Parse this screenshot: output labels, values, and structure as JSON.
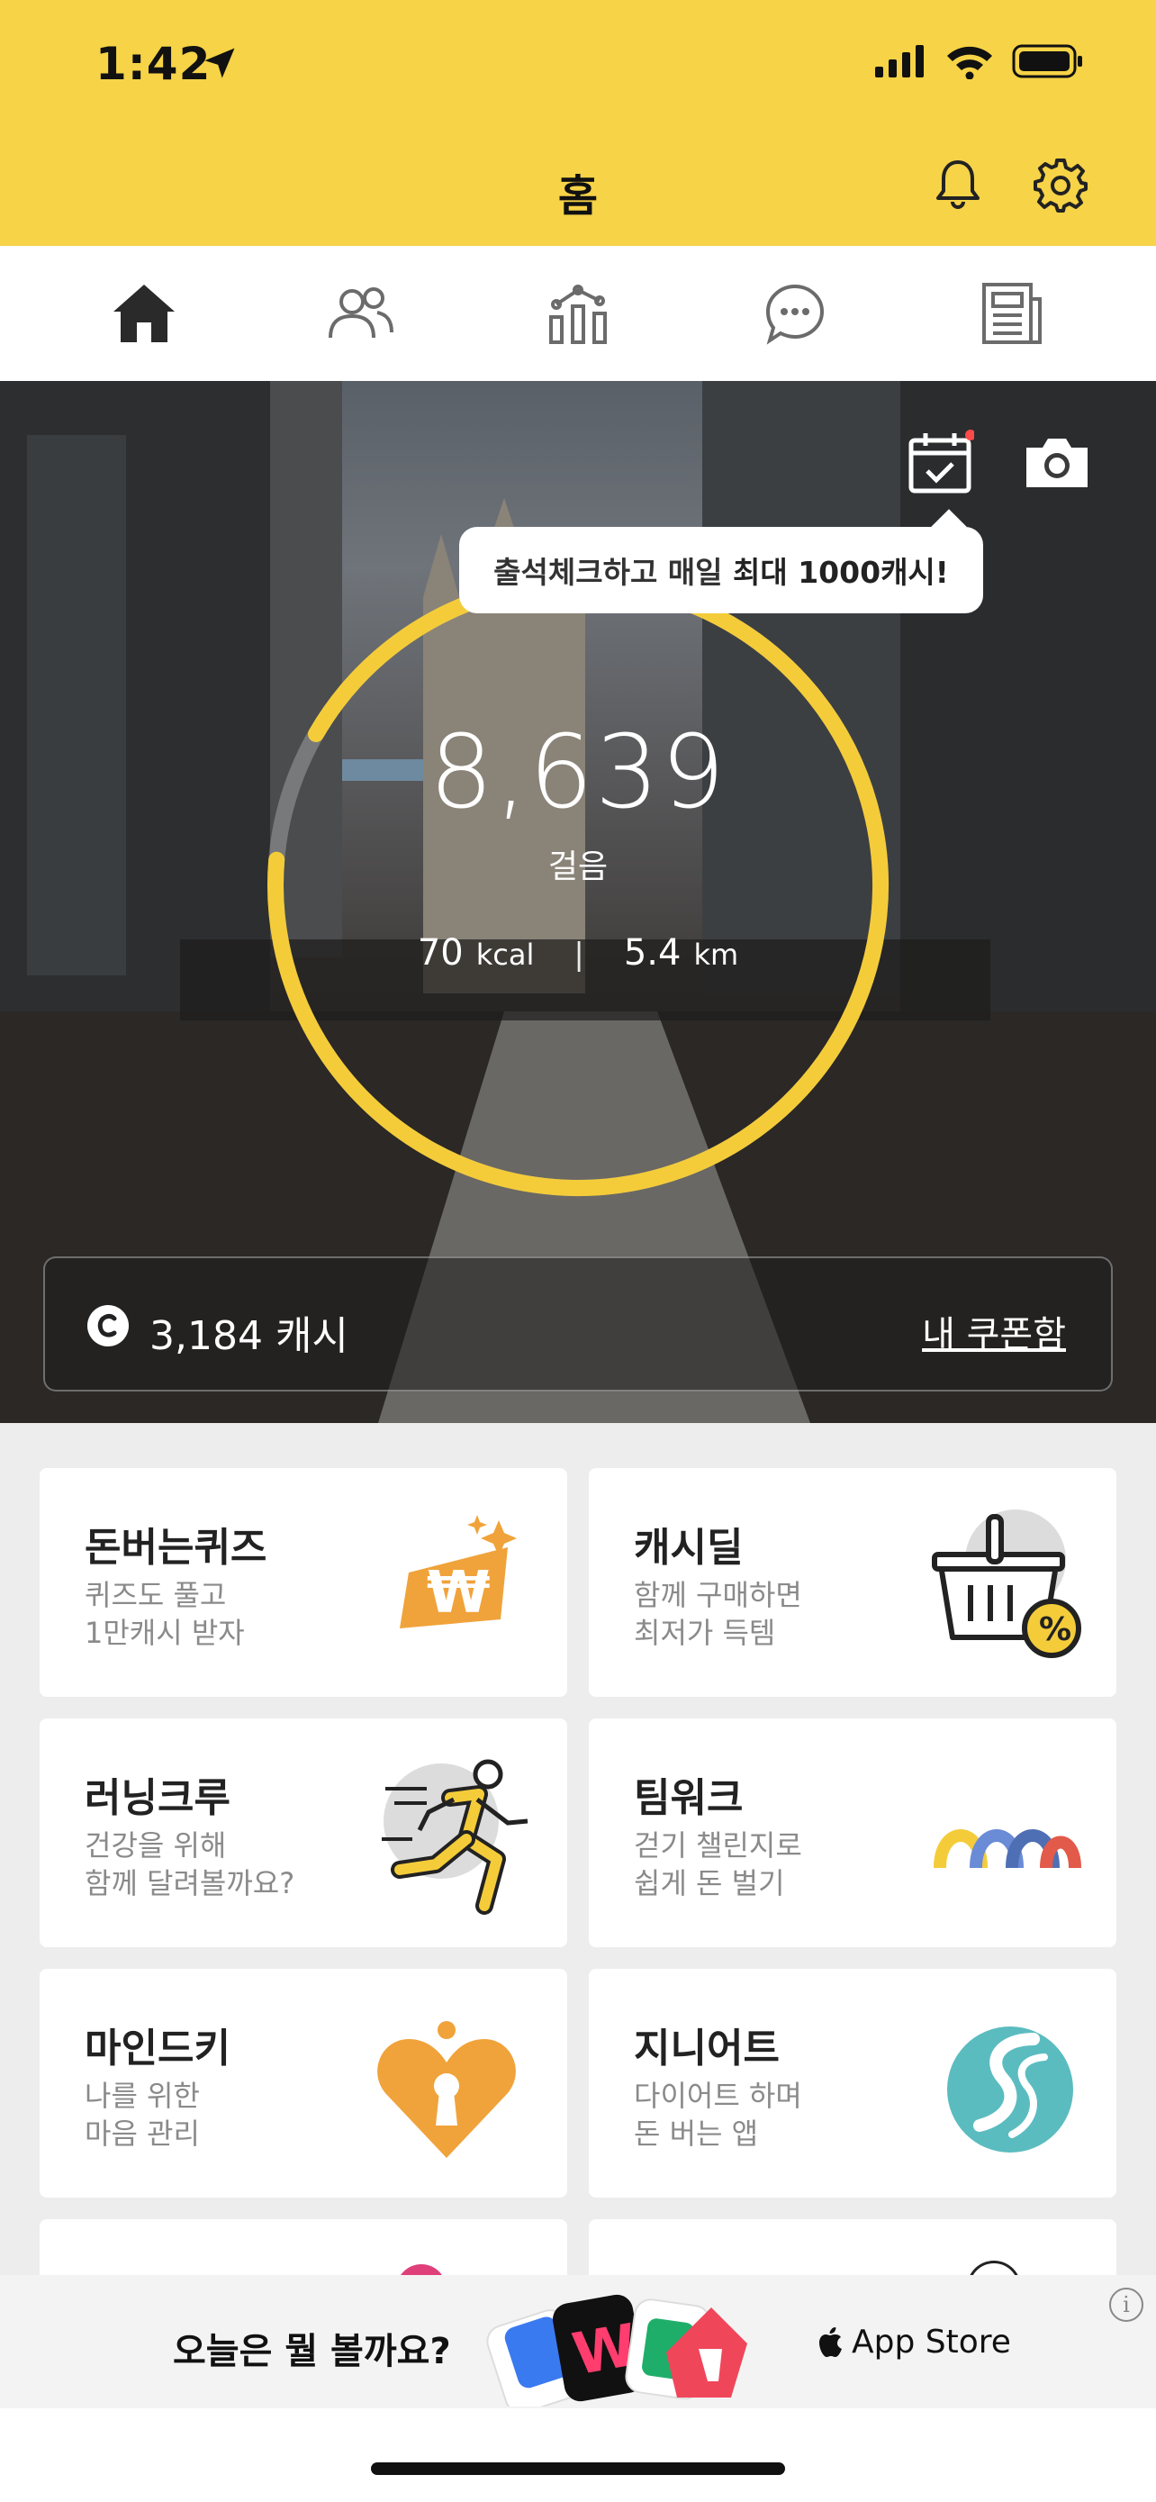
{
  "status_bar": {
    "time": "1:42"
  },
  "header": {
    "title": "홈",
    "icons": [
      "bell-icon",
      "gear-icon"
    ]
  },
  "nav": {
    "items": [
      {
        "icon": "home-icon",
        "active": true
      },
      {
        "icon": "people-icon",
        "active": false
      },
      {
        "icon": "stats-icon",
        "active": false
      },
      {
        "icon": "chat-icon",
        "active": false
      },
      {
        "icon": "news-icon",
        "active": false
      }
    ]
  },
  "hero": {
    "tooltip_prefix": "출석체크하고 매일 ",
    "tooltip_bold": "최대 1000캐시!",
    "steps": "8,639",
    "steps_unit": "걸음",
    "kcal_value": "70",
    "kcal_unit": "kcal",
    "separator": "|",
    "km_value": "5.4",
    "km_unit": "km",
    "step_progress": 0.93,
    "cash_text": "3,184 캐시",
    "coupon_label": "내 쿠폰함"
  },
  "cards": [
    {
      "title": "돈버는퀴즈",
      "sub1": "퀴즈도 풀고",
      "sub2": "1만캐시 받자",
      "icon": "won-sparkle-icon"
    },
    {
      "title": "캐시딜",
      "sub1": "함께 구매하면",
      "sub2": "최저가 득템",
      "icon": "basket-percent-icon"
    },
    {
      "title": "러닝크루",
      "sub1": "건강을 위해",
      "sub2": "함께 달려볼까요?",
      "icon": "runner-icon"
    },
    {
      "title": "팀워크",
      "sub1": "걷기 챌린지로",
      "sub2": "쉽게 돈 벌기",
      "icon": "arches-icon"
    },
    {
      "title": "마인드키",
      "sub1": "나를 위한",
      "sub2": "마음 관리",
      "icon": "heart-keyhole-icon"
    },
    {
      "title": "지니어트",
      "sub1": "다이어트 하며",
      "sub2": "돈 버는 앱",
      "icon": "s-circle-icon"
    }
  ],
  "ad": {
    "text": "오늘은 뭘 볼까요?",
    "store_label": "App Store",
    "info": "i"
  },
  "colors": {
    "brand_yellow": "#f6d347",
    "ring_yellow": "#f4cc3a",
    "accent_orange": "#f0a33a"
  }
}
